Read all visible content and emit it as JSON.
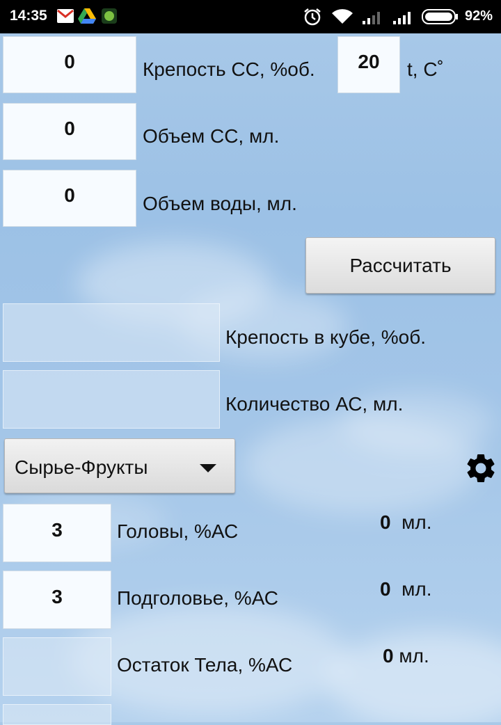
{
  "status_bar": {
    "time": "14:35",
    "battery": "92%",
    "icons": [
      "gmail-icon",
      "drive-icon",
      "app-icon",
      "alarm-icon",
      "wifi-icon",
      "signal-icon",
      "signal-icon",
      "battery-icon"
    ]
  },
  "input": {
    "strength_value": "0",
    "strength_label": "Крепость СС, %об.",
    "temp_value": "20",
    "temp_label": "t, C˚",
    "volume_value": "0",
    "volume_label": "Объем СС, мл.",
    "water_value": "0",
    "water_label": "Объем воды, мл."
  },
  "calculate_label": "Рассчитать",
  "output": {
    "cube_strength_value": "",
    "cube_strength_label": "Крепость в кубе, %об.",
    "as_amount_value": "",
    "as_amount_label": "Количество АС, мл."
  },
  "raw_material": {
    "selected": "Сырье-Фрукты"
  },
  "fractions": [
    {
      "value": "3",
      "label": "Головы, %АС",
      "result_value": "0",
      "result_unit": "мл."
    },
    {
      "value": "3",
      "label": "Подголовье, %АС",
      "result_value": "0",
      "result_unit": "мл."
    },
    {
      "value": "",
      "label": "Остаток Тела, %АС",
      "result_value": "0",
      "result_unit": "мл."
    }
  ]
}
